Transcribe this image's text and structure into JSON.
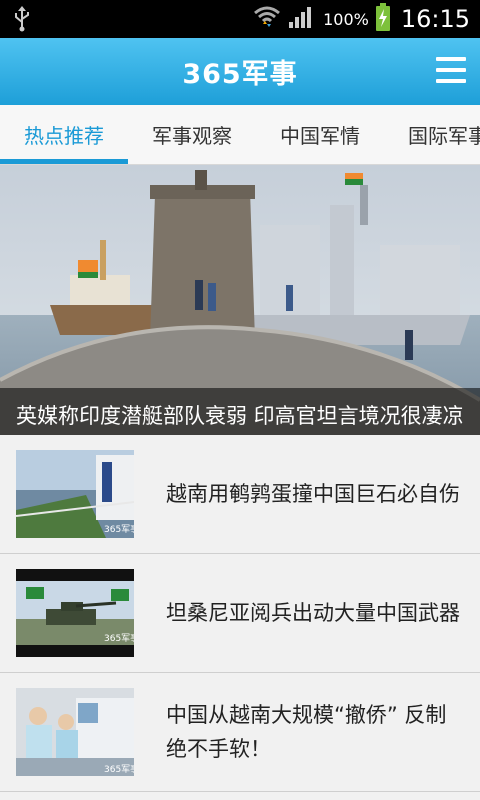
{
  "status_bar": {
    "battery_percent": "100%",
    "time": "16:15"
  },
  "header": {
    "title": "365军事"
  },
  "tabs": [
    {
      "label": "热点推荐",
      "active": true
    },
    {
      "label": "军事观察",
      "active": false
    },
    {
      "label": "中国军情",
      "active": false
    },
    {
      "label": "国际军事",
      "active": false
    }
  ],
  "hero": {
    "caption": "英媒称印度潜艇部队衰弱 印高官坦言境况很凄凉"
  },
  "news": [
    {
      "title": "越南用鹌鹑蛋撞中国巨石必自伤",
      "thumb_watermark": "365军事"
    },
    {
      "title": "坦桑尼亚阅兵出动大量中国武器",
      "thumb_watermark": "365军事"
    },
    {
      "title": "中国从越南大规模“撤侨” 反制绝不手软！",
      "thumb_watermark": "365军事"
    }
  ],
  "colors": {
    "accent": "#1a9ad6",
    "header_top": "#4fc3f1",
    "header_bottom": "#1e9fd8"
  }
}
